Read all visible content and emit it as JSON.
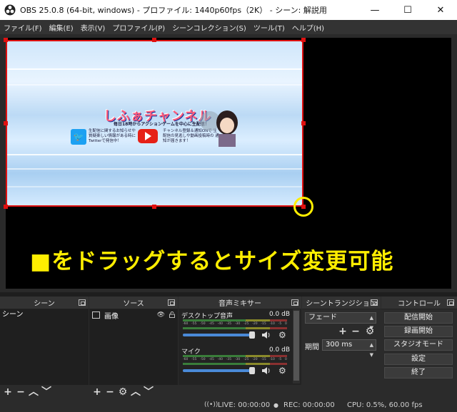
{
  "window": {
    "title": "OBS 25.0.8 (64-bit, windows) - プロファイル: 1440p60fps（2K） - シーン: 解説用",
    "buttons": {
      "minimize": "—",
      "maximize": "☐",
      "close": "✕"
    }
  },
  "menu": [
    "ファイル(F)",
    "編集(E)",
    "表示(V)",
    "プロファイル(P)",
    "シーンコレクション(S)",
    "ツール(T)",
    "ヘルプ(H)"
  ],
  "preview": {
    "source_image": {
      "channel_title": "しふぁチャンネル",
      "channel_subtitle": "毎日18時からアクションゲームを中心に生配信！",
      "twitter_text": "生配信に関するお知らせや 質疑楽しい情報がある時に Twitterで発信中！",
      "youtube_text": "チャンネル登録＆通知ONで 生配信の見逃しや動画投稿時の 通知が届きます！"
    },
    "annotation": "■をドラッグするとサイズ変更可能",
    "colors": {
      "selection": "#e01010",
      "annotation": "#ffee00"
    }
  },
  "docks": {
    "scenes": {
      "title": "シーン",
      "items": [
        "シーン"
      ]
    },
    "sources": {
      "title": "ソース",
      "items": [
        {
          "name": "画像",
          "icon": "image-icon"
        }
      ]
    },
    "mixer": {
      "title": "音声ミキサー",
      "tracks": [
        {
          "name": "デスクトップ音声",
          "db": "0.0 dB",
          "volume": 0.94
        },
        {
          "name": "マイク",
          "db": "0.0 dB",
          "volume": 0.94
        }
      ],
      "scale": [
        "-60",
        "-55",
        "-50",
        "-45",
        "-40",
        "-35",
        "-30",
        "-25",
        "-20",
        "-15",
        "-10",
        "-5",
        "0"
      ]
    },
    "transitions": {
      "title": "シーントランジション",
      "selected": "フェード",
      "duration_label": "期間",
      "duration": "300 ms"
    },
    "controls": {
      "title": "コントロール",
      "buttons": [
        "配信開始",
        "録画開始",
        "スタジオモード",
        "設定",
        "終了"
      ]
    }
  },
  "status": {
    "live": "LIVE: 00:00:00",
    "rec": "REC: 00:00:00",
    "cpu": "CPU: 0.5%, 60.00 fps"
  }
}
